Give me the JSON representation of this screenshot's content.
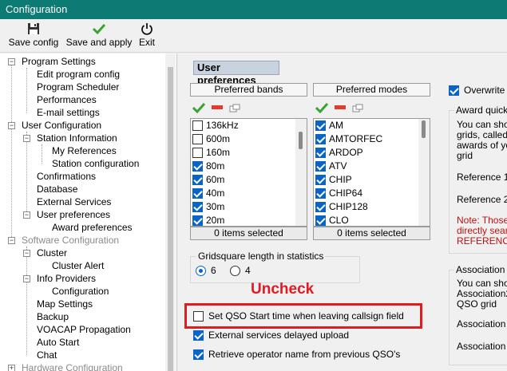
{
  "window": {
    "title": "Configuration"
  },
  "toolbar": {
    "save_config": "Save config",
    "save_apply": "Save and apply",
    "exit": "Exit"
  },
  "tree": {
    "program_settings": "Program Settings",
    "edit_program_config": "Edit program config",
    "program_scheduler": "Program Scheduler",
    "performances": "Performances",
    "email_settings": "E-mail settings",
    "user_configuration": "User Configuration",
    "station_information": "Station Information",
    "my_references": "My References",
    "station_configuration": "Station configuration",
    "confirmations": "Confirmations",
    "database": "Database",
    "external_services": "External Services",
    "user_preferences": "User preferences",
    "award_preferences": "Award preferences",
    "software_configuration": "Software Configuration",
    "cluster": "Cluster",
    "cluster_alert": "Cluster Alert",
    "info_providers": "Info Providers",
    "configuration": "Configuration",
    "map_settings": "Map Settings",
    "backup": "Backup",
    "voacap_propagation": "VOACAP Propagation",
    "auto_start": "Auto Start",
    "chat": "Chat",
    "hardware_configuration": "Hardware Configuration"
  },
  "main": {
    "section_title": "User preferences",
    "bands": {
      "header": "Preferred bands",
      "footer": "0 items selected",
      "items": [
        {
          "label": "136kHz",
          "checked": false
        },
        {
          "label": "600m",
          "checked": false
        },
        {
          "label": "160m",
          "checked": false
        },
        {
          "label": "80m",
          "checked": true
        },
        {
          "label": "60m",
          "checked": true
        },
        {
          "label": "40m",
          "checked": true
        },
        {
          "label": "30m",
          "checked": true
        },
        {
          "label": "20m",
          "checked": true
        }
      ]
    },
    "modes": {
      "header": "Preferred modes",
      "footer": "0 items selected",
      "items": [
        {
          "label": "AM",
          "checked": true
        },
        {
          "label": "AMTORFEC",
          "checked": true
        },
        {
          "label": "ARDOP",
          "checked": true
        },
        {
          "label": "ATV",
          "checked": true
        },
        {
          "label": "CHIP",
          "checked": true
        },
        {
          "label": "CHIP64",
          "checked": true
        },
        {
          "label": "CHIP128",
          "checked": true
        },
        {
          "label": "CLO",
          "checked": true
        }
      ]
    },
    "gridsquare": {
      "title": "Gridsquare length in statistics",
      "option_6": "6",
      "option_4": "4",
      "selected": "6"
    },
    "annotation": "Uncheck",
    "options": {
      "set_qso_start": "Set QSO Start time when leaving callsign field",
      "external_delayed": "External services delayed upload",
      "retrieve_operator": "Retrieve operator name from previous QSO's"
    },
    "right": {
      "overwrite": "Overwrite",
      "award_quick": {
        "title": "Award quick",
        "desc_1": "You can sho",
        "desc_2": "grids, called",
        "desc_3": "awards of yo",
        "desc_4": "grid",
        "reference_1": "Reference 1",
        "reference_2": "Reference 2",
        "note_1": "Note: Those",
        "note_2": "directly sear",
        "note_3": "REFERENCE"
      },
      "association": {
        "title": "Association",
        "desc_1": "You can sho",
        "desc_2": "Association2",
        "desc_3": "QSO grid",
        "assoc_1": "Association",
        "assoc_2": "Association"
      }
    }
  },
  "colors": {
    "titlebar": "#0e7a74",
    "accent_check": "#0a64c8",
    "annotation_red": "#e01b22"
  }
}
